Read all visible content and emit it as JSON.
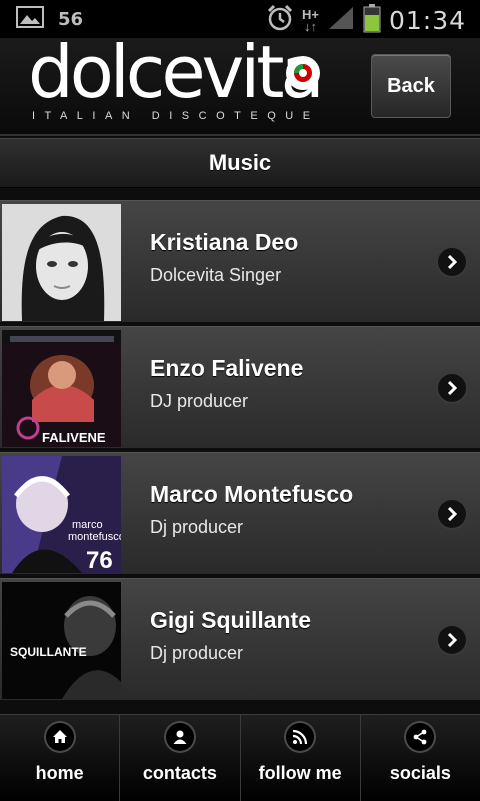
{
  "status_bar": {
    "signal_number": "56",
    "time": "01:34",
    "network": "H+"
  },
  "header": {
    "logo": {
      "main": "dolcevita",
      "sub": "ITALIAN DISCOTEQUE"
    },
    "back_label": "Back"
  },
  "title": "Music",
  "artists": [
    {
      "name": "Kristiana Deo",
      "role": "Dolcevita Singer"
    },
    {
      "name": "Enzo Falivene",
      "role": "DJ producer"
    },
    {
      "name": "Marco Montefusco",
      "role": "Dj producer"
    },
    {
      "name": "Gigi Squillante",
      "role": "Dj producer"
    }
  ],
  "tabs": [
    {
      "label": "home",
      "icon": "home-icon"
    },
    {
      "label": "contacts",
      "icon": "person-icon"
    },
    {
      "label": "follow me",
      "icon": "rss-icon"
    },
    {
      "label": "socials",
      "icon": "share-icon"
    }
  ]
}
